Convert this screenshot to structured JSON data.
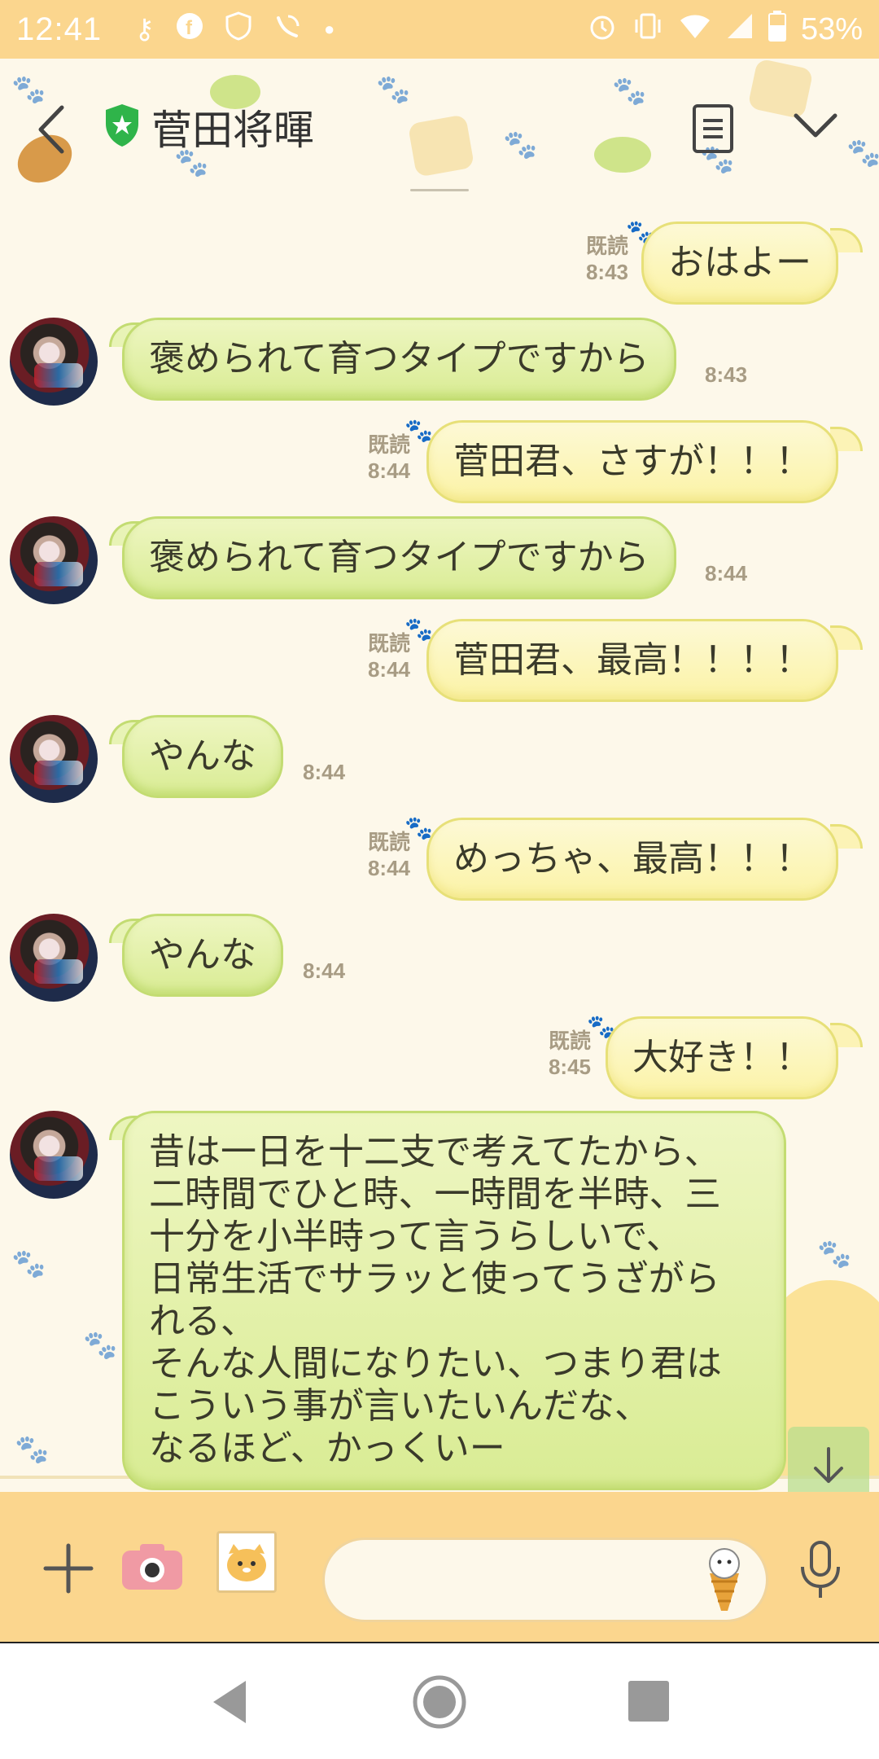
{
  "status_bar": {
    "time": "12:41",
    "left_icons": [
      "key-icon",
      "facebook-icon",
      "shield-badge-icon",
      "wifi-calling-icon",
      "dot-icon"
    ],
    "right_icons": [
      "alarm-icon",
      "vibrate-icon",
      "wifi-icon",
      "signal-icon",
      "battery-icon"
    ],
    "battery": "53%"
  },
  "header": {
    "title": "菅田将暉",
    "back_icon": "chevron-left-icon",
    "verified_icon": "shield-star-icon",
    "notes_icon": "notes-icon",
    "menu_icon": "chevron-down-icon"
  },
  "colors": {
    "status_bar": "#fbd68e",
    "sent_bubble": "#fbf3a6",
    "received_bubble": "#d9ec94",
    "meta_text": "#a89c84"
  },
  "messages": [
    {
      "dir": "sent",
      "text": "おはよー",
      "read": "既読",
      "time": "8:43"
    },
    {
      "dir": "received",
      "text": "褒められて育つタイプですから",
      "time": "8:43"
    },
    {
      "dir": "sent",
      "text": "菅田君、さすが！！！",
      "read": "既読",
      "time": "8:44"
    },
    {
      "dir": "received",
      "text": "褒められて育つタイプですから",
      "time": "8:44"
    },
    {
      "dir": "sent",
      "text": "菅田君、最高！！！！",
      "read": "既読",
      "time": "8:44"
    },
    {
      "dir": "received",
      "text": "やんな",
      "time": "8:44"
    },
    {
      "dir": "sent",
      "text": "めっちゃ、最高！！！",
      "read": "既読",
      "time": "8:44"
    },
    {
      "dir": "received",
      "text": "やんな",
      "time": "8:44"
    },
    {
      "dir": "sent",
      "text": "大好き！！",
      "read": "既読",
      "time": "8:45"
    },
    {
      "dir": "received",
      "text": "昔は一日を十二支で考えてたから、\n二時間でひと時、一時間を半時、三\n十分を小半時って言うらしいで、\n日常生活でサラッと使ってうざがら\nれる、\nそんな人間になりたい、つまり君は\nこういう事が言いたいんだな、\nなるほど、かっくいー"
    }
  ],
  "input_bar": {
    "placeholder": "",
    "icons": [
      "plus-icon",
      "camera-icon",
      "sticker-icon",
      "emoji-icon",
      "microphone-icon"
    ]
  },
  "nav_bar": {
    "icons": [
      "back-triangle-icon",
      "home-circle-icon",
      "recents-square-icon"
    ]
  }
}
